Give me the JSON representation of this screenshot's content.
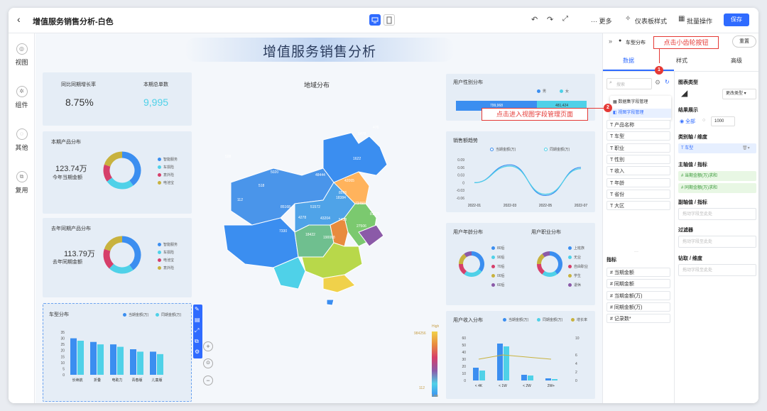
{
  "topbar": {
    "title": "增值服务销售分析-白色",
    "more": "··· 更多",
    "dashboard_style": "仪表板样式",
    "batch": "批量操作",
    "save": "保存"
  },
  "leftnav": {
    "items": [
      {
        "label": "视图"
      },
      {
        "label": "组件"
      },
      {
        "label": "其他"
      },
      {
        "label": "复用"
      }
    ]
  },
  "canvas": {
    "title": "增值服务销售分析",
    "kpi": {
      "growth_label": "同比同期增长率",
      "growth_value": "8.75%",
      "orders_label": "本期总单数",
      "orders_value": "9,995"
    },
    "current_products": {
      "title": "本期产品分布",
      "amount": "123.74万",
      "sub": "今年当期金额",
      "legend": [
        "智能服务",
        "车损险",
        "意外险",
        "电池宝"
      ]
    },
    "last_products": {
      "title": "去年同期产品分布",
      "amount": "113.79万",
      "sub": "去年同期金额",
      "legend": [
        "智能服务",
        "车损险",
        "电池宝",
        "意外险"
      ]
    },
    "car_type": {
      "title": "车型分布",
      "legend": [
        "当期金额(万)",
        "同期金额(万)"
      ],
      "yticks": [
        "35",
        "30",
        "25",
        "20",
        "15",
        "10",
        "5",
        "0"
      ]
    },
    "map": {
      "title": "地域分布",
      "high": "High",
      "low": "Low",
      "max": "984256",
      "min": "112",
      "labels": [
        "476",
        "1478",
        "508",
        "1622",
        "5020",
        "518",
        "48444",
        "42065",
        "8576",
        "18384",
        "73450",
        "81675",
        "112",
        "85168",
        "51572",
        "4278",
        "43204",
        "5418",
        "7330",
        "18422",
        "190068",
        "27506"
      ]
    },
    "gender": {
      "title": "用户性别分布",
      "legend": [
        "男",
        "女"
      ],
      "male_value": "799,968",
      "female_value": "481,424"
    },
    "trend": {
      "title": "销售额趋势",
      "legend": [
        "当期金额(万)",
        "同期金额(万)"
      ]
    },
    "age": {
      "title": "用户年龄分布",
      "legend": [
        "80后",
        "90后",
        "70后",
        "00后",
        "60后"
      ]
    },
    "job": {
      "title": "用户职业分布",
      "legend": [
        "上班族",
        "无业",
        "自由职业",
        "学生",
        "退休"
      ]
    },
    "income": {
      "title": "用户收入分布",
      "legend": [
        "当期金额(万)",
        "同期金额(万)",
        "增长率"
      ],
      "yticks": [
        "60",
        "50",
        "40",
        "30",
        "20",
        "10",
        "0"
      ],
      "y2ticks": [
        "10",
        "6",
        "4",
        "2",
        "0"
      ]
    }
  },
  "rpanel": {
    "header": "车型分布",
    "reset": "重置",
    "tabs": [
      "数据",
      "样式",
      "高级"
    ],
    "search_placeholder": "搜索",
    "menu": [
      "数据集字段管理",
      "视图字段管理"
    ],
    "dims": [
      "产品名称",
      "车型",
      "职业",
      "性别",
      "收入",
      "年龄",
      "省份",
      "大区"
    ],
    "measures_title": "指标",
    "measures": [
      "当期金额",
      "同期金额",
      "当期金额(万)",
      "同期金额(万)",
      "记录数*"
    ],
    "chart_type_label": "图表类型",
    "change_type": "更改类型",
    "result_label": "结果展示",
    "result_all": "全部",
    "result_count": "1000",
    "category_label": "类别轴 / 维度",
    "category_value": "车型",
    "main_axis_label": "主轴值 / 指标",
    "main_axis": [
      "当期金额(万)求和",
      "同期金额(万)求和"
    ],
    "sub_axis_label": "副轴值 / 指标",
    "drop_hint": "拖动字段至此处",
    "filter_label": "过滤器",
    "drill_label": "钻取 / 维度"
  },
  "annotations": {
    "gear_tip": "点击小齿轮按钮",
    "view_tip": "点击进入视图字段管理页面"
  },
  "chart_data": [
    {
      "type": "bar",
      "title": "车型分布",
      "categories": [
        "长续航",
        "折叠",
        "电助力",
        "青春版",
        "儿童版"
      ],
      "ylim": [
        0,
        35
      ],
      "series": [
        {
          "name": "当期金额(万)",
          "values": [
            30,
            27,
            25,
            21,
            19
          ]
        },
        {
          "name": "同期金额(万)",
          "values": [
            28,
            25,
            23,
            19,
            17
          ]
        }
      ]
    },
    {
      "type": "line",
      "title": "销售额趋势",
      "categories": [
        "2022-01",
        "2022-03",
        "2022-05",
        "2022-07"
      ],
      "yticks": [
        "0.09",
        "0.06",
        "0.03",
        "0",
        "-0.03",
        "-0.06"
      ],
      "ylim": [
        -0.06,
        0.09
      ],
      "series": [
        {
          "name": "当期金额(万)",
          "values": [
            0.0,
            0.07,
            -0.05,
            0.06
          ]
        },
        {
          "name": "同期金额(万)",
          "values": [
            0.0,
            0.065,
            -0.045,
            0.055
          ]
        }
      ]
    },
    {
      "type": "bar",
      "title": "用户收入分布",
      "categories": [
        "< 4K",
        "< 1W",
        "< 2W",
        "2W+"
      ],
      "ylim": [
        0,
        60
      ],
      "series": [
        {
          "name": "当期金额(万)",
          "values": [
            18,
            52,
            8,
            3
          ]
        },
        {
          "name": "同期金额(万)",
          "values": [
            14,
            48,
            7,
            2
          ]
        },
        {
          "name": "增长率",
          "values": [
            5,
            6,
            5.5,
            5
          ]
        }
      ]
    },
    {
      "type": "pie",
      "title": "本期产品分布",
      "categories": [
        "智能服务",
        "车损险",
        "意外险",
        "电池宝"
      ],
      "values": [
        40,
        25,
        15,
        20
      ]
    },
    {
      "type": "pie",
      "title": "去年同期产品分布",
      "categories": [
        "智能服务",
        "车损险",
        "电池宝",
        "意外险"
      ],
      "values": [
        40,
        22,
        18,
        20
      ]
    },
    {
      "type": "pie",
      "title": "用户年龄分布",
      "categories": [
        "80后",
        "90后",
        "70后",
        "00后",
        "60后"
      ],
      "values": [
        35,
        25,
        15,
        15,
        10
      ]
    },
    {
      "type": "pie",
      "title": "用户职业分布",
      "categories": [
        "上班族",
        "无业",
        "自由职业",
        "学生",
        "退休"
      ],
      "values": [
        40,
        20,
        15,
        15,
        10
      ]
    }
  ],
  "colors": {
    "accent": "#2f6bff",
    "blue": "#3b8ef0",
    "cyan": "#4fd1e8",
    "red": "#d63f6a",
    "olive": "#c8b23e",
    "purple": "#8b5aa8"
  }
}
